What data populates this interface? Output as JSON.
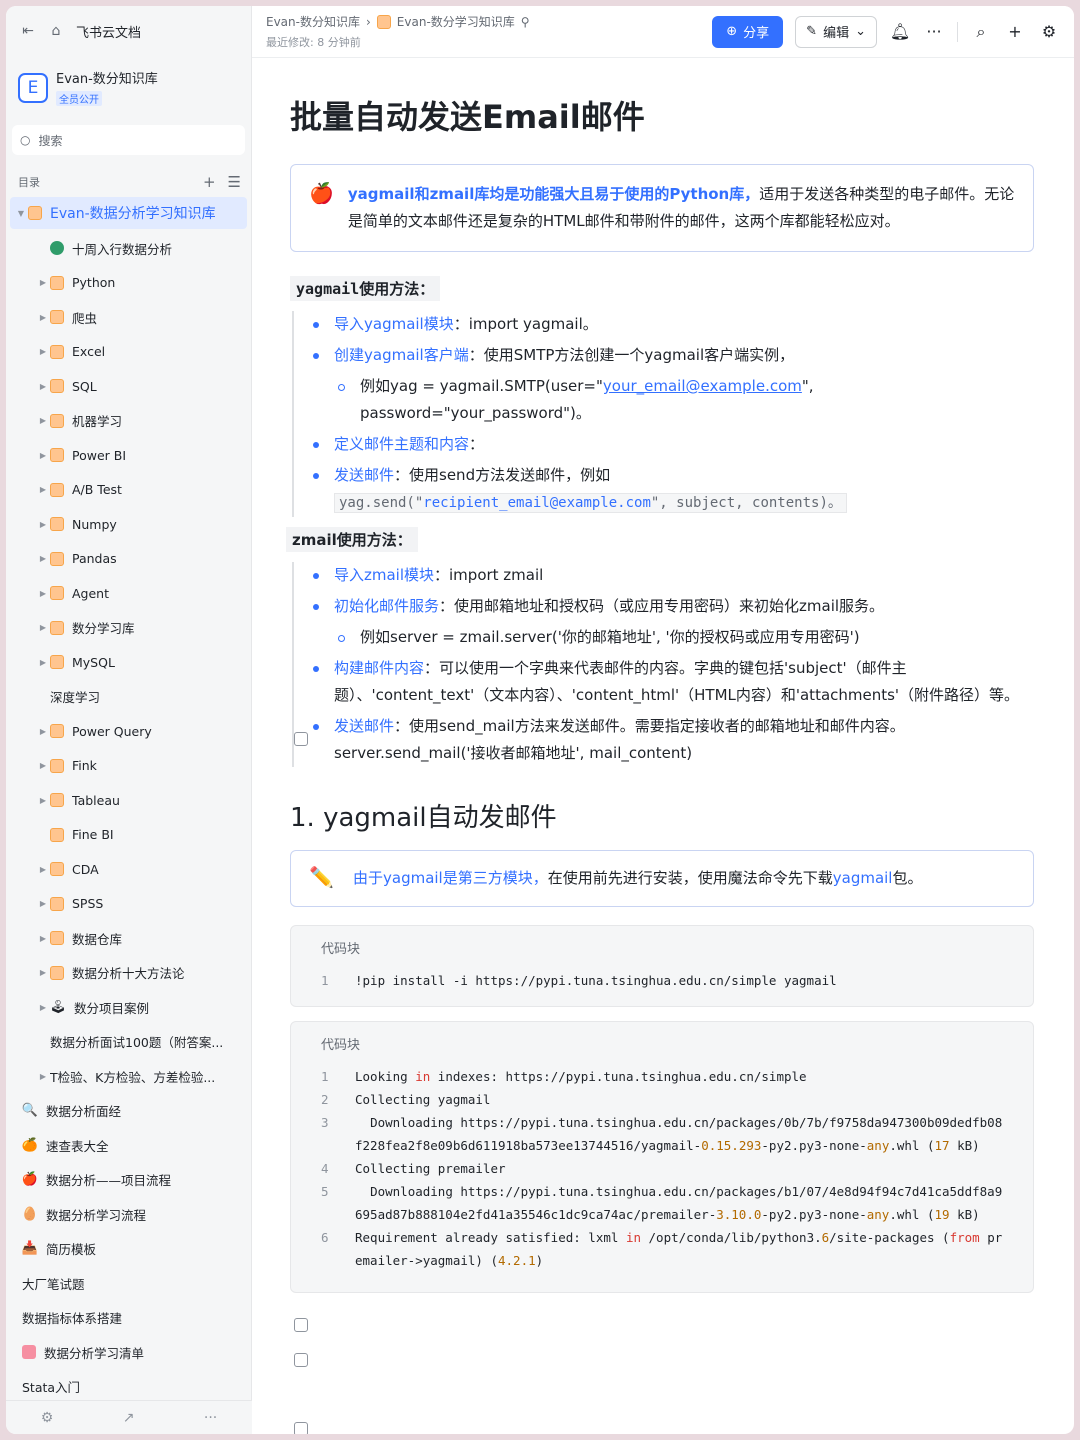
{
  "sidebar": {
    "app_title": "飞书云文档",
    "kb_name": "Evan-数分知识库",
    "kb_tag": "全员公开",
    "search_placeholder": "搜索",
    "toc_label": "目录",
    "root_item": "Evan-数据分析学习知识库",
    "items": [
      {
        "label": "十周入行数据分析",
        "icon": "globe",
        "arrow": false,
        "level": 1
      },
      {
        "label": "Python",
        "icon": "folder",
        "arrow": true,
        "level": 1
      },
      {
        "label": "爬虫",
        "icon": "folder",
        "arrow": true,
        "level": 1
      },
      {
        "label": "Excel",
        "icon": "folder",
        "arrow": true,
        "level": 1
      },
      {
        "label": "SQL",
        "icon": "folder",
        "arrow": true,
        "level": 1
      },
      {
        "label": "机器学习",
        "icon": "folder",
        "arrow": true,
        "level": 1
      },
      {
        "label": "Power BI",
        "icon": "folder",
        "arrow": true,
        "level": 1
      },
      {
        "label": "A/B Test",
        "icon": "folder",
        "arrow": true,
        "level": 1
      },
      {
        "label": "Numpy",
        "icon": "folder",
        "arrow": true,
        "level": 1
      },
      {
        "label": "Pandas",
        "icon": "folder",
        "arrow": true,
        "level": 1
      },
      {
        "label": "Agent",
        "icon": "folder",
        "arrow": true,
        "level": 1
      },
      {
        "label": "数分学习库",
        "icon": "folder",
        "arrow": true,
        "level": 1
      },
      {
        "label": "MySQL",
        "icon": "folder",
        "arrow": true,
        "level": 1
      },
      {
        "label": "深度学习",
        "icon": "doc",
        "arrow": false,
        "level": 1
      },
      {
        "label": "Power Query",
        "icon": "folder",
        "arrow": true,
        "level": 1
      },
      {
        "label": "Fink",
        "icon": "folder",
        "arrow": true,
        "level": 1
      },
      {
        "label": "Tableau",
        "icon": "folder",
        "arrow": true,
        "level": 1
      },
      {
        "label": "Fine BI",
        "icon": "folder",
        "arrow": false,
        "level": 1
      },
      {
        "label": "CDA",
        "icon": "folder",
        "arrow": true,
        "level": 1
      },
      {
        "label": "SPSS",
        "icon": "folder",
        "arrow": true,
        "level": 1
      },
      {
        "label": "数据仓库",
        "icon": "folder",
        "arrow": true,
        "level": 1
      },
      {
        "label": "数据分析十大方法论",
        "icon": "folder",
        "arrow": true,
        "level": 1
      },
      {
        "label": "数分项目案例",
        "icon": "emoji-joystick",
        "arrow": true,
        "level": 1
      },
      {
        "label": "数据分析面试100题（附答案...",
        "icon": "doc",
        "arrow": false,
        "level": 1
      },
      {
        "label": "T检验、K方检验、方差检验...",
        "icon": "doc",
        "arrow": true,
        "level": 1
      },
      {
        "label": "数据分析面经",
        "icon": "emoji-magnifier",
        "arrow": false,
        "level": 0
      },
      {
        "label": "速查表大全",
        "icon": "emoji-orange",
        "arrow": false,
        "level": 0
      },
      {
        "label": "数据分析——项目流程",
        "icon": "emoji-apple",
        "arrow": false,
        "level": 0
      },
      {
        "label": "数据分析学习流程",
        "icon": "emoji-egg",
        "arrow": false,
        "level": 0
      },
      {
        "label": "简历模板",
        "icon": "emoji-inbox",
        "arrow": false,
        "level": 0
      },
      {
        "label": "大厂笔试题",
        "icon": "doc",
        "arrow": false,
        "level": 0
      },
      {
        "label": "数据指标体系搭建",
        "icon": "doc",
        "arrow": false,
        "level": 0
      },
      {
        "label": "数据分析学习清单",
        "icon": "pink",
        "arrow": false,
        "level": 0
      },
      {
        "label": "Stata入门",
        "icon": "doc",
        "arrow": false,
        "level": 0
      }
    ]
  },
  "topbar": {
    "crumb_1": "Evan-数分知识库",
    "crumb_2": "Evan-数分学习知识库",
    "last_modified": "最近修改: 8 分钟前",
    "share_label": "分享",
    "edit_label": "编辑"
  },
  "doc": {
    "title": "批量自动发送Email邮件",
    "callout_1": {
      "emoji": "🍎",
      "lead": "yagmail和zmail库均是功能强大且易于使用的Python库，",
      "rest": "适用于发送各种类型的电子邮件。无论是简单的文本邮件还是复杂的HTML邮件和带附件的邮件，这两个库都能轻松应对。"
    },
    "yagmail_heading": "yagmail使用方法：",
    "yag_items": [
      {
        "key": "导入yagmail模块",
        "text": "：import yagmail。"
      },
      {
        "key": "创建yagmail客户端",
        "text": "：使用SMTP方法创建一个yagmail客户端实例，"
      }
    ],
    "yag_sub_pre": "例如yag = yagmail.SMTP(user=\"",
    "yag_sub_email": "your_email@example.com",
    "yag_sub_post": "\", password=\"your_password\")。",
    "yag_item3_key": "定义邮件主题和内容",
    "yag_item3_text": "：",
    "yag_item4_key": "发送邮件",
    "yag_item4_text": "：使用send方法发送邮件，例如",
    "yag_code_pre": "yag.send(\"",
    "yag_code_str": "recipient_email@example.com",
    "yag_code_post": "\", subject, contents)。",
    "zmail_heading": "zmail使用方法：",
    "z_items": [
      {
        "key": "导入zmail模块",
        "text": "：import zmail"
      },
      {
        "key": "初始化邮件服务",
        "text": "：使用邮箱地址和授权码（或应用专用密码）来初始化zmail服务。"
      }
    ],
    "z_sub": "例如server = zmail.server('你的邮箱地址', '你的授权码或应用专用密码')",
    "z_item3_key": "构建邮件内容",
    "z_item3_text": "：可以使用一个字典来代表邮件的内容。字典的键包括'subject'（邮件主题）、'content_text'（文本内容）、'content_html'（HTML内容）和'attachments'（附件路径）等。",
    "z_item4_key": "发送邮件",
    "z_item4_text": "：使用send_mail方法来发送邮件。需要指定接收者的邮箱地址和邮件内容。server.send_mail('接收者邮箱地址', mail_content)",
    "h2": "1. yagmail自动发邮件",
    "callout_2": {
      "emoji": "✏️",
      "blue1": "由于yagmail是第三方模块，",
      "mid": "在使用前先进行安装，使用魔法命令先下载",
      "blue2": "yagmail",
      "end": "包。"
    },
    "code1": {
      "label": "代码块",
      "lines": [
        {
          "n": "1",
          "t": "!pip install -i https://pypi.tuna.tsinghua.edu.cn/simple yagmail"
        }
      ]
    },
    "code2": {
      "label": "代码块"
    }
  }
}
